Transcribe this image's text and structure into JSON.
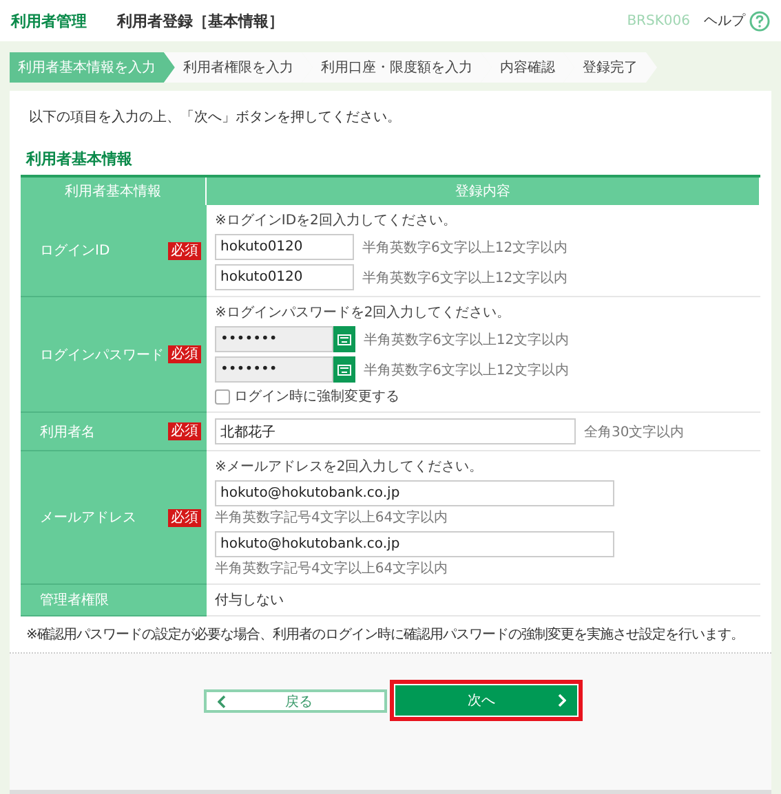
{
  "header": {
    "section": "利用者管理",
    "title": "利用者登録［基本情報］",
    "screen_id": "BRSK006",
    "help": "ヘルプ"
  },
  "steps": [
    {
      "label": "利用者基本情報を入力",
      "selected": true
    },
    {
      "label": "利用者権限を入力",
      "selected": false
    },
    {
      "label": "利用口座・限度額を入力",
      "selected": false
    },
    {
      "label": "内容確認",
      "selected": false
    },
    {
      "label": "登録完了",
      "selected": false
    }
  ],
  "intro": "以下の項目を入力の上、「次へ」ボタンを押してください。",
  "section_title": "利用者基本情報",
  "table": {
    "columns": [
      "利用者基本情報",
      "登録内容"
    ],
    "rows": [
      {
        "label": "ログインID",
        "required": true,
        "required_badge": "必須",
        "note": "※ログインIDを2回入力してください。",
        "fields": [
          {
            "kind": "text",
            "value": "hokuto0120",
            "hint": "半角英数字6文字以上12文字以内"
          },
          {
            "kind": "text",
            "value": "hokuto0120",
            "hint": "半角英数字6文字以上12文字以内"
          }
        ]
      },
      {
        "label": "ログインパスワード",
        "required": true,
        "required_badge": "必須",
        "note": "※ログインパスワードを2回入力してください。",
        "fields": [
          {
            "kind": "password",
            "value": "•••••••",
            "hint": "半角英数字6文字以上12文字以内"
          },
          {
            "kind": "password",
            "value": "•••••••",
            "hint": "半角英数字6文字以上12文字以内"
          }
        ],
        "checkbox": {
          "label": "ログイン時に強制変更する",
          "checked": false
        }
      },
      {
        "label": "利用者名",
        "required": true,
        "required_badge": "必須",
        "fields": [
          {
            "kind": "wide",
            "value": "北都花子",
            "hint": "全角30文字以内"
          }
        ]
      },
      {
        "label": "メールアドレス",
        "required": true,
        "required_badge": "必須",
        "note": "※メールアドレスを2回入力してください。",
        "fields": [
          {
            "kind": "email",
            "value": "hokuto@hokutobank.co.jp",
            "hint": "半角英数字記号4文字以上64文字以内"
          },
          {
            "kind": "email",
            "value": "hokuto@hokutobank.co.jp",
            "hint": "半角英数字記号4文字以上64文字以内"
          }
        ]
      },
      {
        "label": "管理者権限",
        "required": false,
        "value": "付与しない"
      }
    ]
  },
  "footnote": "※確認用パスワードの設定が必要な場合、利用者のログイン時に確認用パスワードの強制変更を実施させ設定を行います。",
  "buttons": [
    {
      "kind": "back",
      "label": "戻る",
      "highlighted": false
    },
    {
      "kind": "next",
      "label": "次へ",
      "highlighted": true
    }
  ]
}
